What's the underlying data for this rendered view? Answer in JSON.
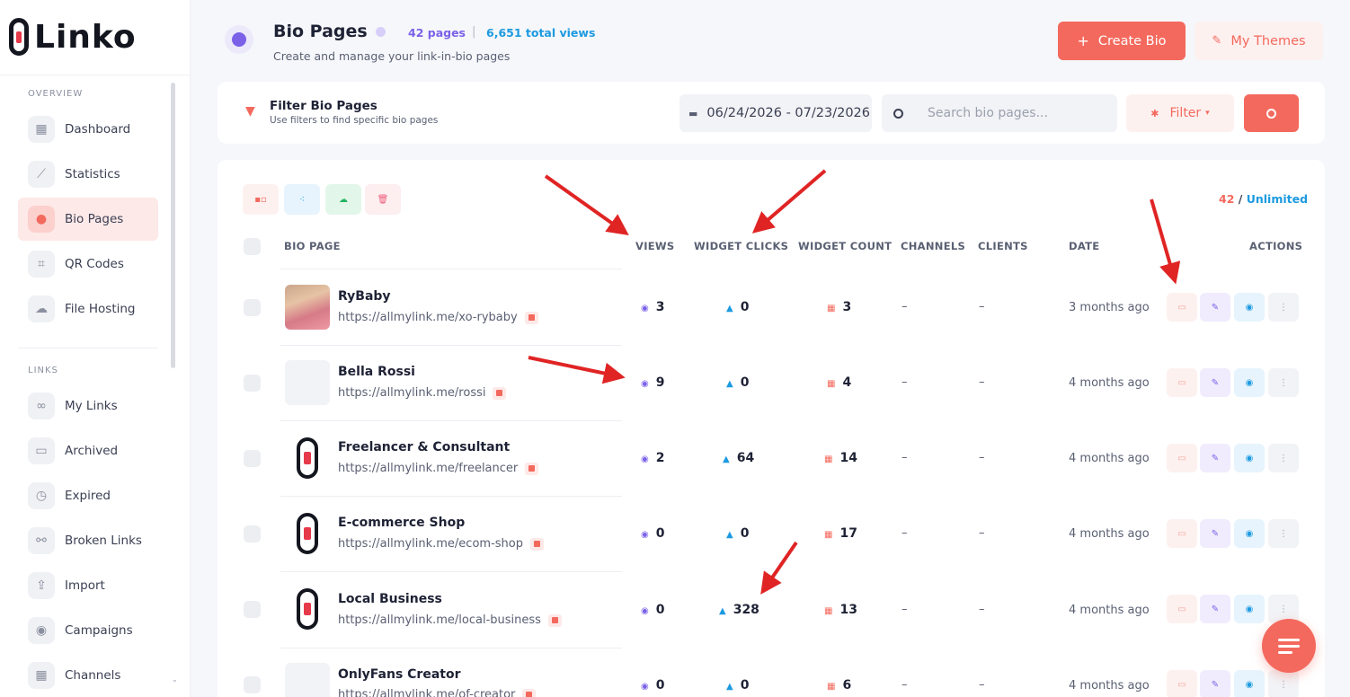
{
  "brand": {
    "name": "Linko"
  },
  "sidebar": {
    "sections": [
      {
        "title": "OVERVIEW",
        "items": [
          {
            "label": "Dashboard",
            "icon": "grid-icon"
          },
          {
            "label": "Statistics",
            "icon": "chart-icon"
          },
          {
            "label": "Bio Pages",
            "icon": "users-icon",
            "active": true
          },
          {
            "label": "QR Codes",
            "icon": "qr-icon"
          },
          {
            "label": "File Hosting",
            "icon": "cloud-icon"
          }
        ]
      },
      {
        "title": "LINKS",
        "items": [
          {
            "label": "My Links",
            "icon": "link-icon"
          },
          {
            "label": "Archived",
            "icon": "archive-icon"
          },
          {
            "label": "Expired",
            "icon": "clock-icon"
          },
          {
            "label": "Broken Links",
            "icon": "broken-link-icon"
          },
          {
            "label": "Import",
            "icon": "import-icon"
          },
          {
            "label": "Campaigns",
            "icon": "target-icon"
          },
          {
            "label": "Channels",
            "icon": "channels-icon"
          }
        ]
      }
    ]
  },
  "header": {
    "title": "Bio Pages",
    "pages_count": "42 pages",
    "separator": "|",
    "total_views": "6,651 total views",
    "subtitle": "Create and manage your link-in-bio pages",
    "create_button": "Create Bio",
    "themes_button": "My Themes"
  },
  "filters": {
    "title": "Filter Bio Pages",
    "subtitle": "Use filters to find specific bio pages",
    "date_range": "06/24/2026 - 07/23/2026",
    "search_placeholder": "Search bio pages...",
    "filter_button": "Filter"
  },
  "quota": {
    "used": "42",
    "separator": "/",
    "limit": "Unlimited"
  },
  "table": {
    "headers": {
      "bio_page": "BIO PAGE",
      "views": "VIEWS",
      "widget_clicks": "WIDGET CLICKS",
      "widget_count": "WIDGET COUNT",
      "channels": "CHANNELS",
      "clients": "CLIENTS",
      "date": "DATE",
      "actions": "ACTIONS"
    },
    "rows": [
      {
        "name": "RyBaby",
        "url": "https://allmylink.me/xo-rybaby",
        "views": "3",
        "clicks": "0",
        "widgets": "3",
        "channels": "–",
        "clients": "–",
        "date": "3 months ago"
      },
      {
        "name": "Bella Rossi",
        "url": "https://allmylink.me/rossi",
        "views": "9",
        "clicks": "0",
        "widgets": "4",
        "channels": "–",
        "clients": "–",
        "date": "4 months ago"
      },
      {
        "name": "Freelancer & Consultant",
        "url": "https://allmylink.me/freelancer",
        "views": "2",
        "clicks": "64",
        "widgets": "14",
        "channels": "–",
        "clients": "–",
        "date": "4 months ago"
      },
      {
        "name": "E-commerce Shop",
        "url": "https://allmylink.me/ecom-shop",
        "views": "0",
        "clicks": "0",
        "widgets": "17",
        "channels": "–",
        "clients": "–",
        "date": "4 months ago"
      },
      {
        "name": "Local Business",
        "url": "https://allmylink.me/local-business",
        "views": "0",
        "clicks": "328",
        "widgets": "13",
        "channels": "–",
        "clients": "–",
        "date": "4 months ago"
      },
      {
        "name": "OnlyFans Creator",
        "url": "https://allmylink.me/of-creator",
        "views": "0",
        "clicks": "0",
        "widgets": "6",
        "channels": "–",
        "clients": "–",
        "date": "4 months ago"
      }
    ]
  },
  "colors": {
    "accent": "#f4695d",
    "purple": "#7b61e8",
    "blue": "#1d9ae0",
    "arrow": "#e02424"
  }
}
